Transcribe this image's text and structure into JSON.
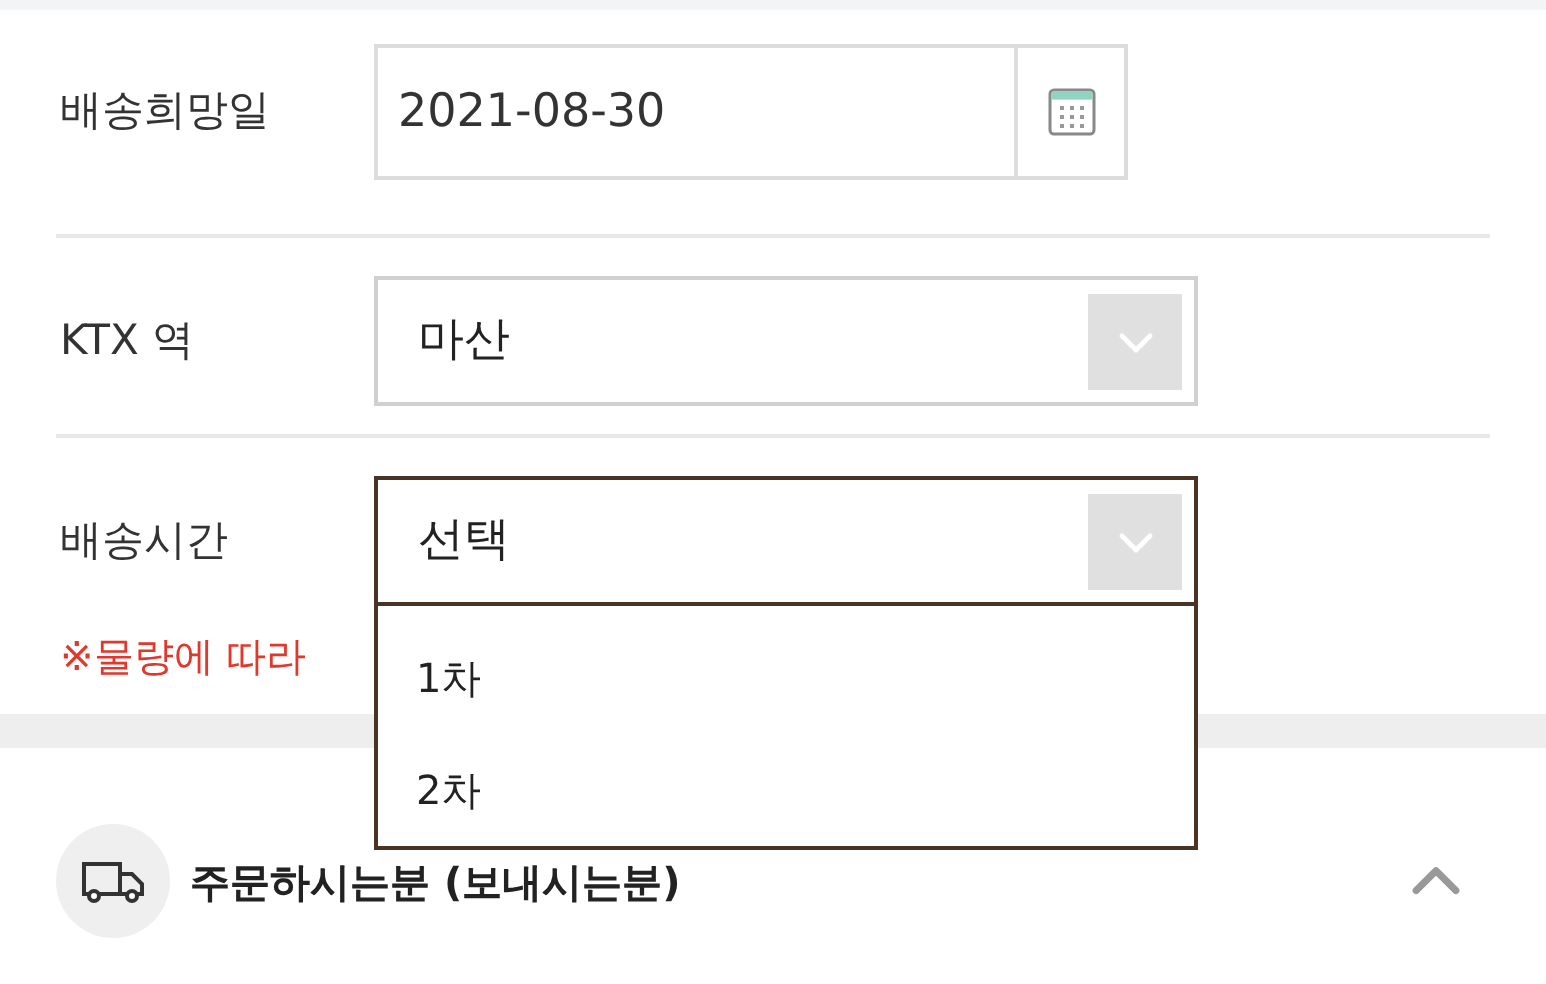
{
  "fields": [
    {
      "kind": "date",
      "label": "배송희망일",
      "value": "2021-08-30"
    },
    {
      "kind": "select",
      "label": "KTX 역",
      "value": "마산",
      "open": false
    },
    {
      "kind": "select",
      "label": "배송시간",
      "value": "선택",
      "open": true,
      "note": "※물량에 따라",
      "options": [
        {
          "label": "1차",
          "selected": false
        },
        {
          "label": "2차",
          "selected": false
        }
      ]
    }
  ],
  "section": {
    "title": "주문하시는분 (보내시는분)",
    "expanded": true
  }
}
